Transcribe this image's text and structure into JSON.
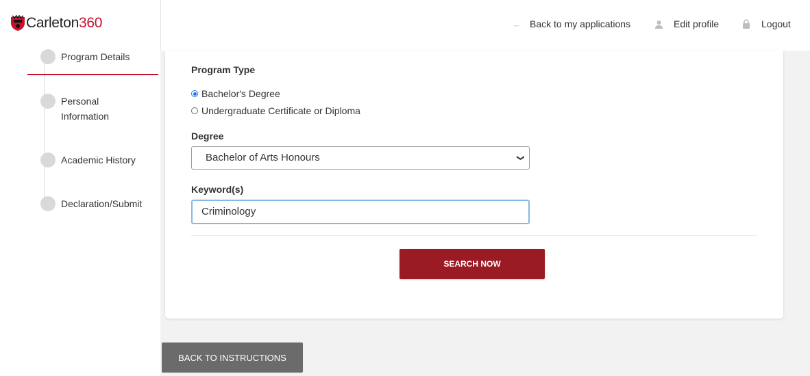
{
  "brand": {
    "name": "Carleton",
    "number": "360",
    "logo_icon": "shield-logo-icon"
  },
  "header": {
    "back_to_applications": "Back to my applications",
    "edit_profile": "Edit profile",
    "logout": "Logout",
    "icons": {
      "back": "arrow-left-icon",
      "profile": "user-icon",
      "logout": "lock-icon"
    }
  },
  "sidebar": {
    "steps": [
      {
        "label": "Program Details",
        "active": true
      },
      {
        "label": "Personal Information",
        "active": false
      },
      {
        "label": "Academic History",
        "active": false
      },
      {
        "label": "Declaration/Submit",
        "active": false
      }
    ]
  },
  "form": {
    "program_type_label": "Program Type",
    "program_type_options": [
      {
        "label": "Bachelor's Degree",
        "selected": true
      },
      {
        "label": "Undergraduate Certificate or Diploma",
        "selected": false
      }
    ],
    "degree_label": "Degree",
    "degree_value": "Bachelor of Arts Honours",
    "keywords_label": "Keyword(s)",
    "keywords_value": "Criminology",
    "search_button": "SEARCH NOW"
  },
  "footer": {
    "back_button": "BACK TO INSTRUCTIONS"
  },
  "colors": {
    "accent": "#c8102e",
    "button_primary": "#9b1b24",
    "button_secondary": "#6b6b6b",
    "radio_selected": "#1a73e8"
  }
}
